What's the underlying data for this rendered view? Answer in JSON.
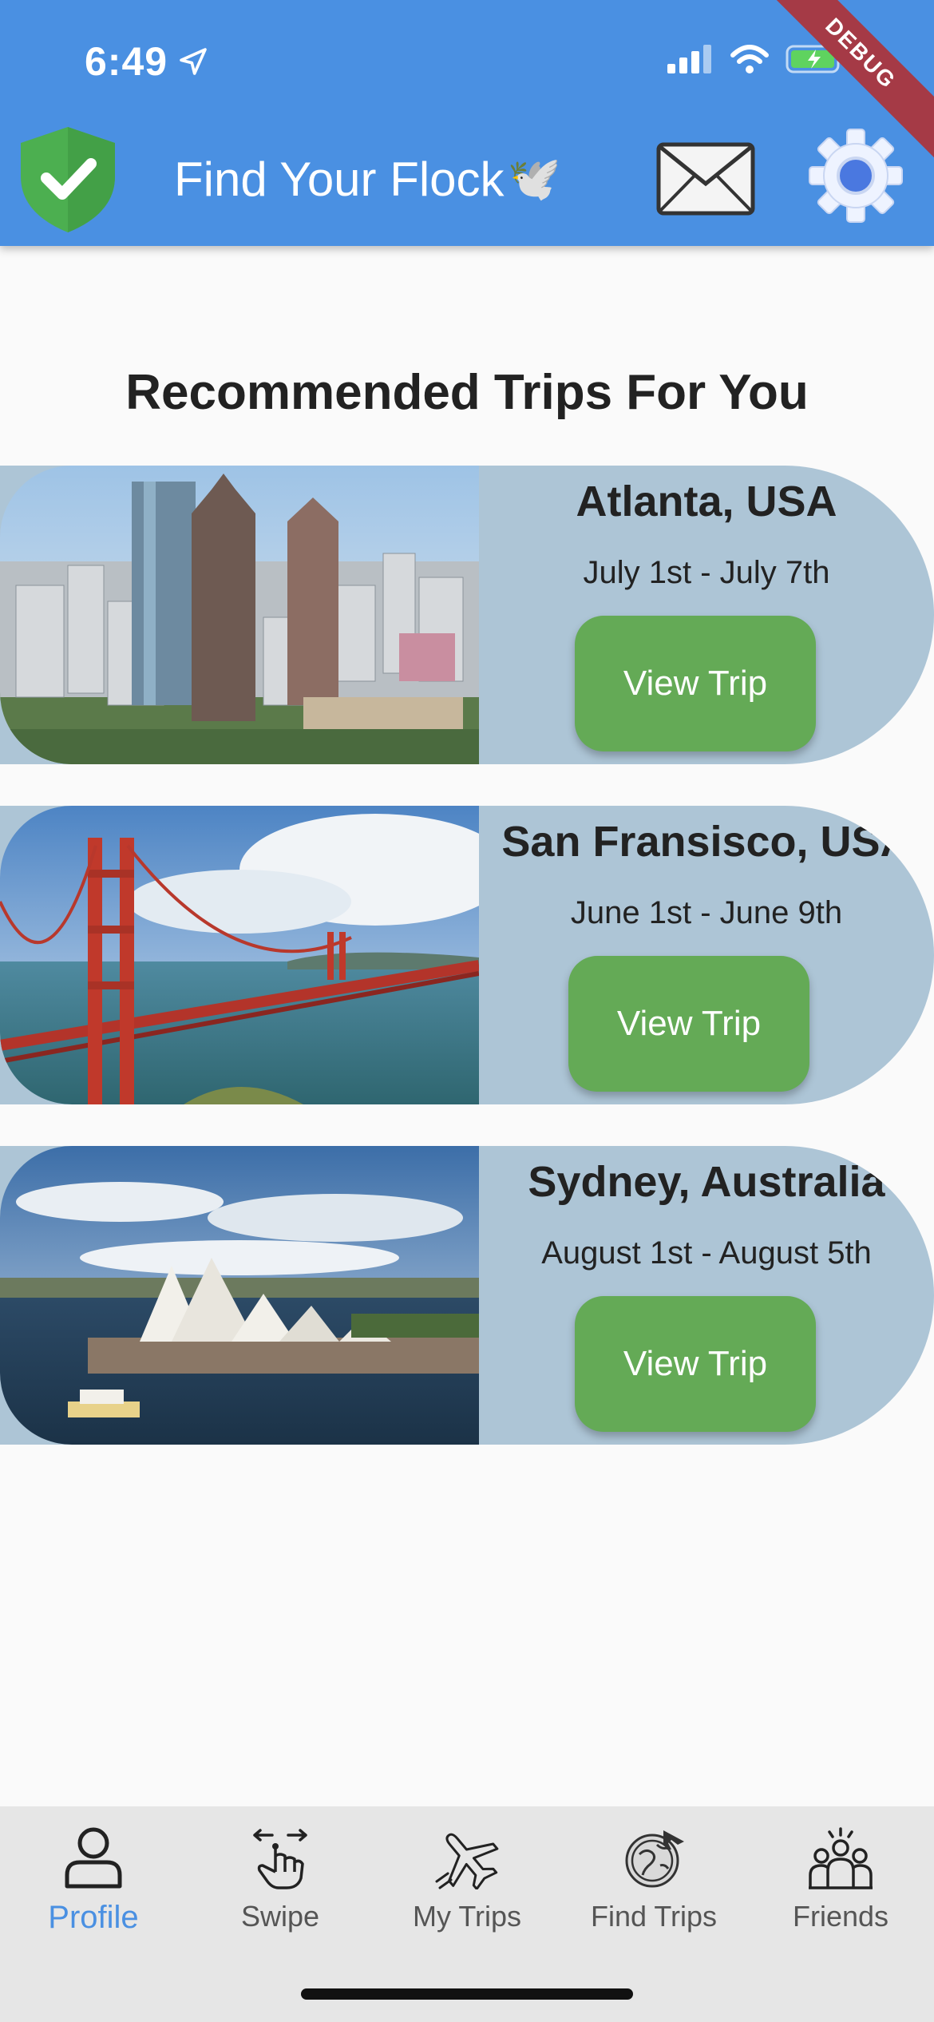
{
  "status_bar": {
    "time": "6:49",
    "debug_label": "DEBUG"
  },
  "app_bar": {
    "title": "Find Your Flock",
    "title_emoji": "🕊️"
  },
  "main": {
    "section_title": "Recommended Trips For You"
  },
  "trips": [
    {
      "city": "Atlanta, USA",
      "dates": "July 1st - July 7th",
      "button_label": "View Trip"
    },
    {
      "city": "San Fransisco, USA",
      "dates": "June 1st - June 9th",
      "button_label": "View Trip"
    },
    {
      "city": "Sydney, Australia",
      "dates": "August 1st - August 5th",
      "button_label": "View Trip"
    }
  ],
  "bottom_nav": {
    "items": [
      {
        "label": "Profile",
        "icon": "profile-icon",
        "active": true
      },
      {
        "label": "Swipe",
        "icon": "swipe-hand-icon",
        "active": false
      },
      {
        "label": "My Trips",
        "icon": "airplane-icon",
        "active": false
      },
      {
        "label": "Find Trips",
        "icon": "globe-plane-icon",
        "active": false
      },
      {
        "label": "Friends",
        "icon": "group-icon",
        "active": false
      }
    ]
  },
  "colors": {
    "app_bar": "#4a90e2",
    "card_background": "#adc5d6",
    "button_green": "#64aa56",
    "active_nav": "#4a90e2",
    "debug_ribbon": "#a53a46"
  }
}
